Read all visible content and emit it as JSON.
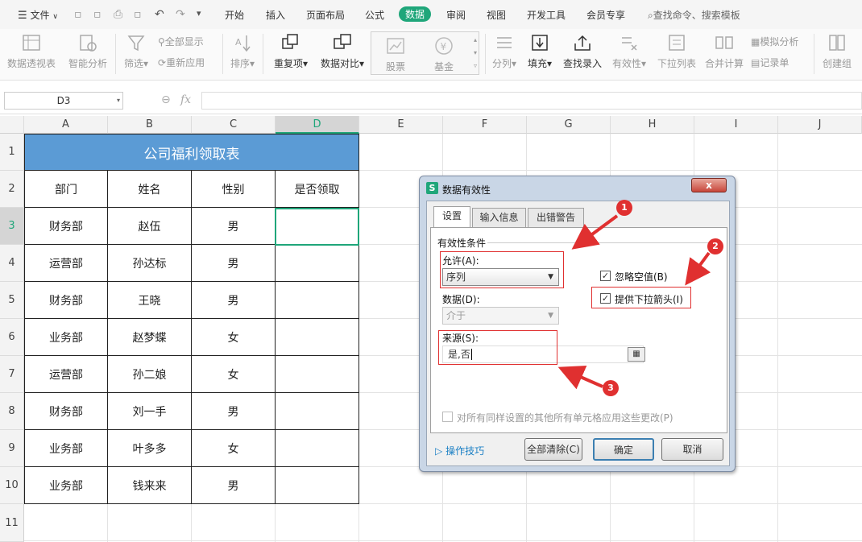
{
  "menubar": {
    "file": "文件",
    "items": [
      "开始",
      "插入",
      "页面布局",
      "公式",
      "数据",
      "审阅",
      "视图",
      "开发工具",
      "会员专享"
    ],
    "active": "数据",
    "search": "查找命令、搜索模板"
  },
  "ribbon": {
    "pivot": "数据透视表",
    "smart": "智能分析",
    "filter": "筛选",
    "show_all": "全部显示",
    "reapply": "重新应用",
    "sort": "排序",
    "dup": "重复项",
    "compare": "数据对比",
    "stock": "股票",
    "fund": "基金",
    "split": "分列",
    "fill": "填充",
    "lookup": "查找录入",
    "validity": "有效性",
    "dropdown": "下拉列表",
    "consolidate": "合并计算",
    "simulate": "模拟分析",
    "record": "记录单",
    "group": "创建组"
  },
  "formula_bar": {
    "name_box": "D3",
    "fx": "fx",
    "formula": ""
  },
  "grid": {
    "columns": [
      "A",
      "B",
      "C",
      "D",
      "E",
      "F",
      "G",
      "H",
      "I",
      "J"
    ],
    "rows": [
      "1",
      "2",
      "3",
      "4",
      "5",
      "6",
      "7",
      "8",
      "9",
      "10",
      "11"
    ],
    "title": "公司福利领取表",
    "headers": [
      "部门",
      "姓名",
      "性别",
      "是否领取"
    ],
    "data": [
      [
        "财务部",
        "赵伍",
        "男",
        ""
      ],
      [
        "运营部",
        "孙达标",
        "男",
        ""
      ],
      [
        "财务部",
        "王晓",
        "男",
        ""
      ],
      [
        "业务部",
        "赵梦蝶",
        "女",
        ""
      ],
      [
        "运营部",
        "孙二娘",
        "女",
        ""
      ],
      [
        "财务部",
        "刘一手",
        "男",
        ""
      ],
      [
        "业务部",
        "叶多多",
        "女",
        ""
      ],
      [
        "业务部",
        "钱来来",
        "男",
        ""
      ]
    ]
  },
  "dialog": {
    "title": "数据有效性",
    "close": "x",
    "tabs": [
      "设置",
      "输入信息",
      "出错警告"
    ],
    "section": "有效性条件",
    "allow_label": "允许(A):",
    "allow_value": "序列",
    "ignore_blank": "忽略空值(B)",
    "provide_dropdown": "提供下拉箭头(I)",
    "data_label": "数据(D):",
    "data_value": "介于",
    "source_label": "来源(S):",
    "source_value": "是,否",
    "apply_all": "对所有同样设置的其他所有单元格应用这些更改(P)",
    "tips": "操作技巧",
    "clear_all": "全部清除(C)",
    "ok": "确定",
    "cancel": "取消"
  },
  "annotations": [
    "1",
    "2",
    "3"
  ],
  "colors": {
    "accent": "#1fa67a",
    "title_fill": "#5b9bd5",
    "annotation": "#e03030"
  }
}
